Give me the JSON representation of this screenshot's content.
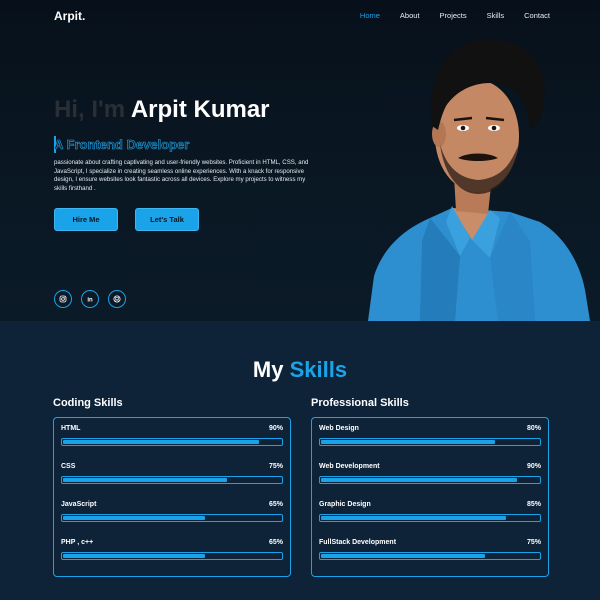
{
  "nav": {
    "logo": "Arpit.",
    "items": [
      {
        "label": "Home",
        "active": true
      },
      {
        "label": "About",
        "active": false
      },
      {
        "label": "Projects",
        "active": false
      },
      {
        "label": "Skills",
        "active": false
      },
      {
        "label": "Contact",
        "active": false
      }
    ]
  },
  "hero": {
    "greeting": "Hi, I'm",
    "name": "Arpit Kumar",
    "role": "A Frontend Developer",
    "description": "passionate about crafting captivating and user-friendly websites. Proficient in HTML, CSS, and JavaScript, I specialize in creating seamless online experiences. With a knack for responsive design, I ensure websites look fantastic across all devices. Explore my projects to witness my skills firsthand .",
    "hire_label": "Hire Me",
    "talk_label": "Let's Talk",
    "socials": [
      "instagram-icon",
      "linkedin-icon",
      "github-icon"
    ]
  },
  "skills": {
    "title_main": "My",
    "title_accent": "Skills",
    "coding_title": "Coding Skills",
    "professional_title": "Professional Skills",
    "coding": [
      {
        "name": "HTML",
        "percent": "90%",
        "level": 0.9
      },
      {
        "name": "CSS",
        "percent": "75%",
        "level": 0.75
      },
      {
        "name": "JavaScript",
        "percent": "65%",
        "level": 0.65
      },
      {
        "name": "PHP , c++",
        "percent": "65%",
        "level": 0.65
      }
    ],
    "professional": [
      {
        "name": "Web Design",
        "percent": "80%",
        "level": 0.8
      },
      {
        "name": "Web Development",
        "percent": "90%",
        "level": 0.9
      },
      {
        "name": "Graphic Design",
        "percent": "85%",
        "level": 0.85
      },
      {
        "name": "FullStack Development",
        "percent": "75%",
        "level": 0.75
      }
    ]
  },
  "colors": {
    "accent": "#1aa3e8",
    "hero_bg": "#07101a",
    "skills_bg": "#0e2338"
  }
}
